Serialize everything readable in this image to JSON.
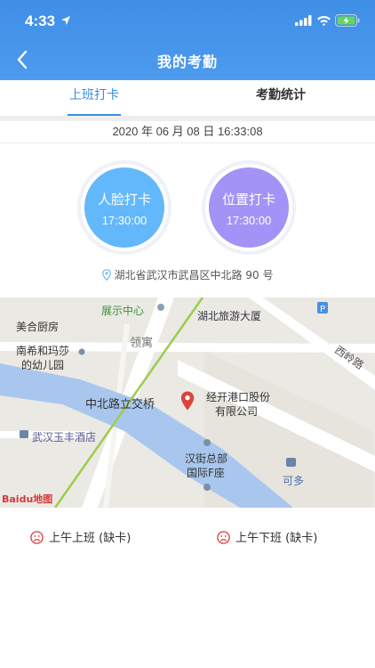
{
  "status_bar": {
    "time": "4:33"
  },
  "header": {
    "title": "我的考勤"
  },
  "tabs": [
    {
      "label": "上班打卡",
      "active": true
    },
    {
      "label": "考勤统计",
      "active": false
    }
  ],
  "datetime": "2020 年 06 月 08 日 16:33:08",
  "punch": {
    "face": {
      "label": "人脸打卡",
      "time": "17:30:00",
      "color": "#62b8fb"
    },
    "location": {
      "label": "位置打卡",
      "time": "17:30:00",
      "color": "#a393f6"
    }
  },
  "address": "湖北省武汉市武昌区中北路 90 号",
  "map": {
    "labels": [
      "展示中心",
      "湖北旅游大厦",
      "美合厨房",
      "领寓",
      "西岭路",
      "南希和玛莎",
      "的幼儿园",
      "中北路立交桥",
      "经开港口股份",
      "有限公司",
      "武汉玉丰酒店",
      "汉街总部",
      "国际F座",
      "可多"
    ],
    "logo": "Baidu地图"
  },
  "records": [
    {
      "label": "上午上班 (缺卡)"
    },
    {
      "label": "上午下班 (缺卡)"
    }
  ],
  "colors": {
    "header": "#4d9bef",
    "accent": "#3a8ee6",
    "face": "#62b8fb",
    "location": "#a393f6",
    "missing": "#d93a3a"
  }
}
